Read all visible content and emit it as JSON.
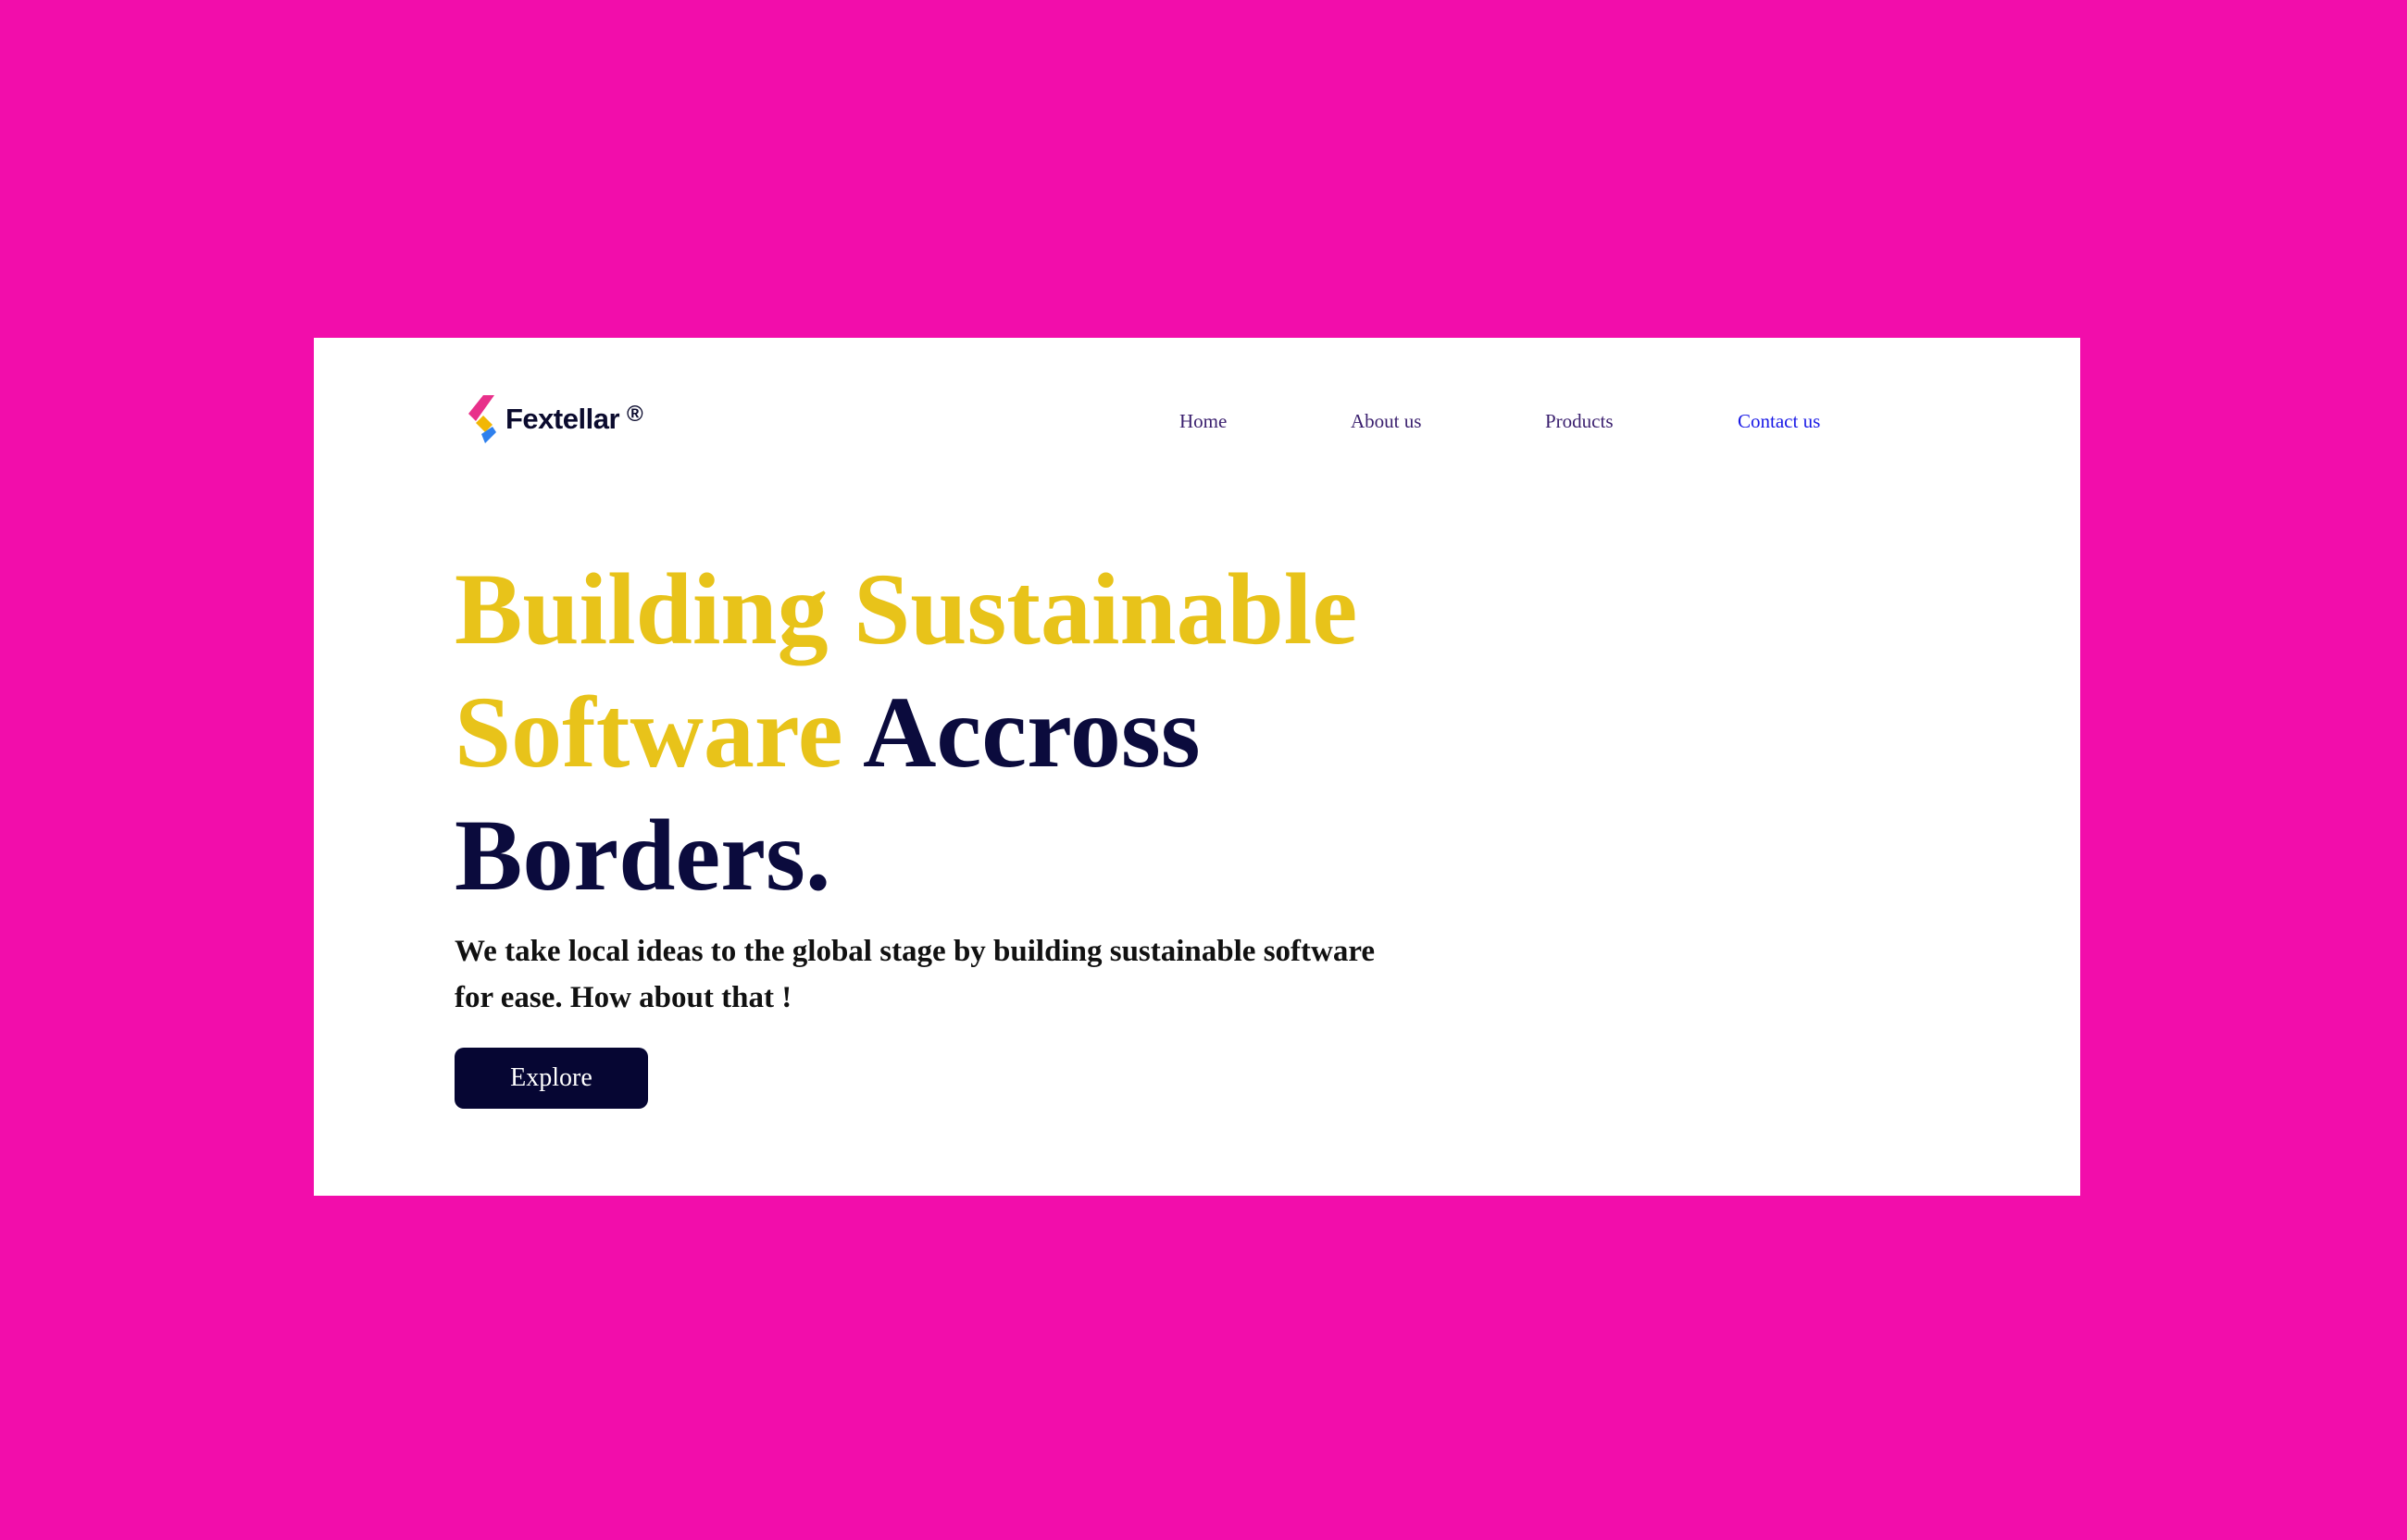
{
  "brand": {
    "name": "Fextellar",
    "registered_mark": "®",
    "icon": "fextellar-logo-mark"
  },
  "nav": {
    "items": [
      {
        "label": "Home"
      },
      {
        "label": "About us"
      },
      {
        "label": "Products"
      },
      {
        "label": "Contact us"
      }
    ]
  },
  "hero": {
    "title_accent_1": "Building Sustainable",
    "title_accent_2": "Software",
    "title_rest_1": "Accross",
    "title_rest_2": "Borders.",
    "subtitle": "We take local ideas to the global stage by building sustainable software for ease. How about that !",
    "cta_label": "Explore"
  },
  "colors": {
    "background": "#f20dab",
    "card": "#ffffff",
    "accent_yellow": "#e8c31a",
    "navy": "#0b0b3d",
    "button": "#060633",
    "nav_text": "#3a1f6e",
    "nav_link_active": "#1a1ae6",
    "logo_pink": "#e8308a",
    "logo_yellow": "#f2b705",
    "logo_blue": "#2f80ed"
  }
}
